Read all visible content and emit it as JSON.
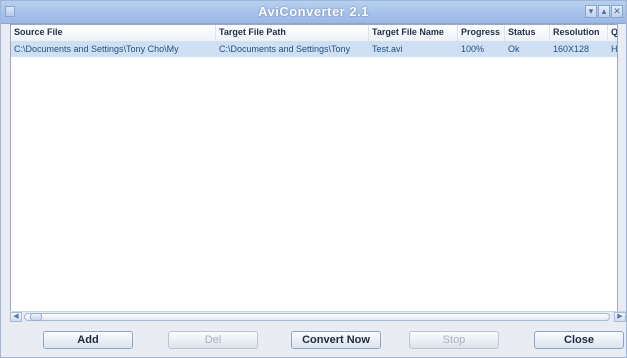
{
  "window": {
    "title": "AviConverter 2.1",
    "controls": [
      "minimize",
      "maximize",
      "close"
    ]
  },
  "table": {
    "columns": [
      "Source File",
      "Target File Path",
      "Target File Name",
      "Progress",
      "Status",
      "Resolution",
      "Qua"
    ],
    "rows": [
      {
        "source": "C:\\Documents and Settings\\Tony Cho\\My",
        "path": "C:\\Documents and Settings\\Tony",
        "name": "Test.avi",
        "progress": "100%",
        "status": "Ok",
        "resolution": "160X128",
        "quality": "High"
      }
    ]
  },
  "buttons": {
    "add": "Add",
    "del": "Del",
    "convert": "Convert Now",
    "stop": "Stop",
    "close": "Close"
  },
  "colors": {
    "selection": "#cfe0f5",
    "titlebar": "#a9c4ea"
  }
}
